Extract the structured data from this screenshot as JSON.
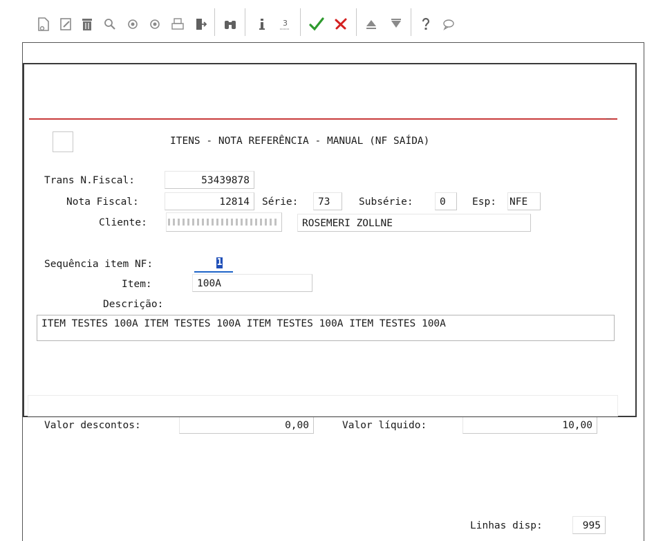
{
  "toolbar": {
    "icons": [
      "new-document-icon",
      "edit-icon",
      "delete-icon",
      "search-icon",
      "previous-icon",
      "next-icon",
      "print-icon",
      "exit-icon",
      "binoculars-icon",
      "info-icon",
      "list-icon",
      "confirm-icon",
      "cancel-icon",
      "up-icon",
      "down-icon",
      "help-icon",
      "comment-icon"
    ],
    "colors": {
      "confirm": "#2e9a2e",
      "cancel": "#d42020",
      "icon": "#8a8a8a"
    }
  },
  "header": {
    "title": "ITENS - NOTA REFERÊNCIA - MANUAL (NF SAÍDA)"
  },
  "fields": {
    "trans_label": "Trans N.Fiscal:",
    "trans_value": "53439878",
    "nota_label": "Nota Fiscal:",
    "nota_value": "12814",
    "serie_label": "Série:",
    "serie_value": "73",
    "subserie_label": "Subsérie:",
    "subserie_value": "0",
    "esp_label": "Esp:",
    "esp_value": "NFE",
    "cliente_label": "Cliente:",
    "cliente_name": "ROSEMERI ZOLLNE",
    "seq_label": "Sequência item NF:",
    "seq_value": "1",
    "item_label": "Item:",
    "item_value": "100A",
    "desc_label": "Descrição:",
    "desc_value": "ITEM TESTES 100A ITEM TESTES 100A ITEM TESTES 100A ITEM TESTES 100A"
  },
  "bottom": {
    "descontos_label": "Valor descontos:",
    "descontos_value": "0,00",
    "liquido_label": "Valor líquido:",
    "liquido_value": "10,00",
    "linhas_label": "Linhas disp:",
    "linhas_value": "995"
  }
}
